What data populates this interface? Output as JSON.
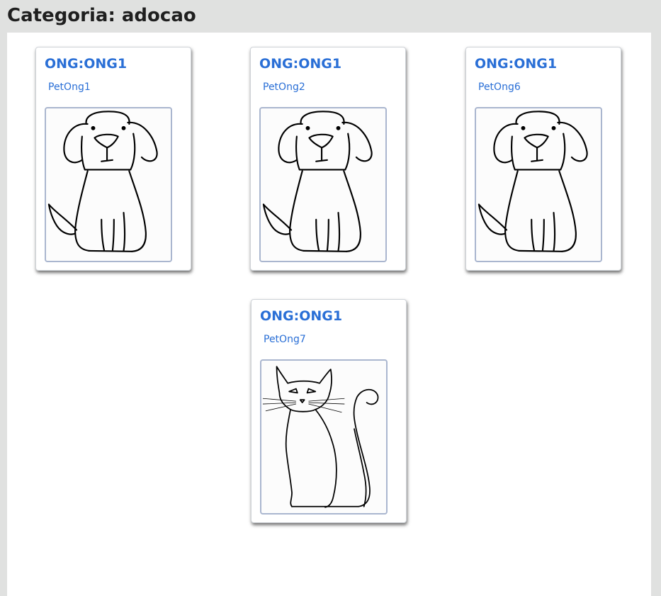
{
  "page": {
    "title": "Categoria: adocao"
  },
  "cards": [
    {
      "ong": "ONG:ONG1",
      "pet": "PetOng1",
      "image": "dog-drawing"
    },
    {
      "ong": "ONG:ONG1",
      "pet": "PetOng2",
      "image": "dog-drawing"
    },
    {
      "ong": "ONG:ONG1",
      "pet": "PetOng6",
      "image": "dog-drawing"
    },
    {
      "ong": "ONG:ONG1",
      "pet": "PetOng7",
      "image": "cat-drawing"
    }
  ],
  "colors": {
    "background": "#e0e1e0",
    "panel": "#ffffff",
    "link": "#2a6fd6",
    "image_border": "#aab6cf",
    "title": "#1f1f1f"
  }
}
